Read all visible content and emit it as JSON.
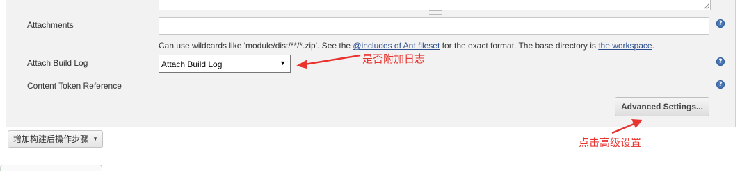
{
  "form": {
    "attachments": {
      "label": "Attachments",
      "value": ""
    },
    "hint": {
      "prefix": "Can use wildcards like 'module/dist/**/*.zip'. See the ",
      "link1": "@includes of Ant fileset",
      "middle": " for the exact format. The base directory is ",
      "link2": "the workspace",
      "suffix": "."
    },
    "attach_build_log": {
      "label": "Attach Build Log",
      "selected": "Attach Build Log"
    },
    "content_token_reference": {
      "label": "Content Token Reference"
    },
    "help_icon_glyph": "?",
    "advanced_button": "Advanced Settings..."
  },
  "post_build_button": {
    "label": "增加构建后操作步骤"
  },
  "annotations": {
    "attach_log_note": "是否附加日志",
    "advanced_note": "点击高级设置",
    "color": "#e8332f"
  },
  "icons": [
    "help-icon",
    "dropdown-caret-icon"
  ]
}
